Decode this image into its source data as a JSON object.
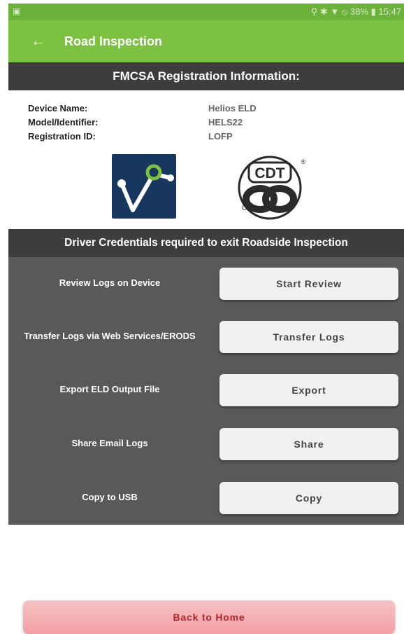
{
  "status_bar": {
    "time": "15:47",
    "battery": "38%",
    "icons": [
      "notification-icon",
      "location-icon",
      "bluetooth-icon",
      "wifi-icon",
      "do-not-disturb-icon",
      "battery-icon"
    ]
  },
  "app_bar": {
    "title": "Road Inspection",
    "back_icon": "arrow-left-icon",
    "color": "#7cc142"
  },
  "registration": {
    "header": "FMCSA Registration Information:",
    "fields": [
      {
        "label": "Device Name:",
        "value": "Helios ELD"
      },
      {
        "label": "Model/Identifier:",
        "value": "HELS22"
      },
      {
        "label": "Registration ID:",
        "value": "LOFP"
      }
    ],
    "logos": {
      "cdt_text": "CDT",
      "cdt_registered": "®",
      "cdt_c": "C"
    }
  },
  "credentials_header": "Driver Credentials required to exit Roadside Inspection",
  "actions": [
    {
      "label": "Review Logs on Device",
      "button": "Start Review"
    },
    {
      "label": "Transfer Logs via Web Services/ERODS",
      "button": "Transfer Logs"
    },
    {
      "label": "Export ELD Output File",
      "button": "Export"
    },
    {
      "label": "Share Email Logs",
      "button": "Share"
    },
    {
      "label": "Copy to USB",
      "button": "Copy"
    }
  ],
  "back_home": "Back to Home"
}
